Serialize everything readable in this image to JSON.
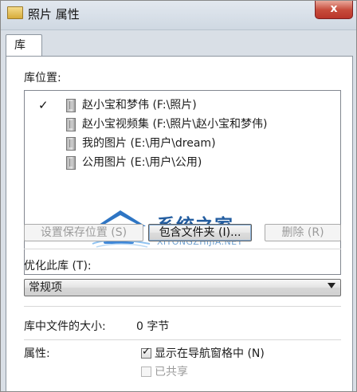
{
  "window": {
    "title": "照片 属性",
    "close_glyph": "x"
  },
  "tab": {
    "label": "库"
  },
  "library_locations": {
    "label": "库位置:",
    "items": [
      {
        "checked": true,
        "check_glyph": "✓",
        "text": "赵小宝和梦伟 (F:\\照片)"
      },
      {
        "checked": false,
        "check_glyph": "",
        "text": "赵小宝视频集 (F:\\照片\\赵小宝和梦伟)"
      },
      {
        "checked": false,
        "check_glyph": "",
        "text": "我的图片 (E:\\用户\\dream)"
      },
      {
        "checked": false,
        "check_glyph": "",
        "text": "公用图片 (E:\\用户\\公用)"
      }
    ]
  },
  "watermark": {
    "title": "系统之家",
    "subtitle": "XITONGZHIJIA.NET"
  },
  "buttons": {
    "set_save_location": "设置保存位置 (S)",
    "include_folder": "包含文件夹 (I)...",
    "remove": "删除 (R)"
  },
  "optimize": {
    "label": "优化此库 (T):",
    "value": "常规项"
  },
  "library_size": {
    "label": "库中文件的大小:",
    "value": "0 字节"
  },
  "attributes": {
    "label": "属性:",
    "show_in_nav_label": "显示在导航窗格中 (N)",
    "shared_label": "已共享",
    "show_in_nav_checked": true,
    "shared_checked": false
  },
  "colors": {
    "accent": "#235da0",
    "watermark_light": "#6fa0cf",
    "close_red": "#c74c3c"
  },
  "icons": {
    "window_icon": "library-folder-icon",
    "library_item": "library-folder-icon",
    "checkmark": "checkmark-icon",
    "dropdown": "chevron-down-icon",
    "watermark": "house-logo-icon"
  }
}
